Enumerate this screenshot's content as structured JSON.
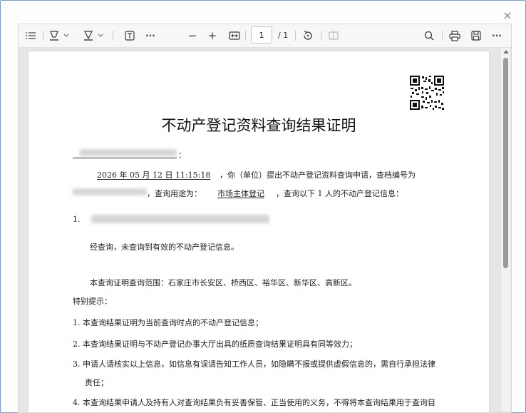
{
  "window": {
    "close_glyph": "×"
  },
  "toolbar": {
    "icons": [
      "list-icon",
      "highlight-icon",
      "draw-icon",
      "text-box-icon",
      "more-icon",
      "zoom-out-icon",
      "zoom-in-icon",
      "fit-width-icon",
      "rotate-icon",
      "page-view-icon",
      "search-icon",
      "print-icon",
      "save-icon",
      "more-icon"
    ],
    "zoom_out": "−",
    "zoom_in": "+",
    "more": "···",
    "page_current": "1",
    "page_total": "/ 1"
  },
  "document": {
    "title": "不动产登记资料查询结果证明",
    "addressee_suffix": "：",
    "query_date": "2026 年 05 月 12 日  11:15:18",
    "line1_mid": "，你（单位）提出不动产登记资料查询申请，查档编号为",
    "line2_mid": "，查询用途为：",
    "purpose": "市场主体登记",
    "line2_tail": "，查询以下 1 人的不动产登记信息：",
    "item1_number": "1.",
    "result_text": "经查询，未查询到有效的不动产登记信息。",
    "scope_text": "本查询证明查询范围：石家庄市长安区、桥西区、裕华区、新华区、高新区。",
    "notice_title": "特别提示：",
    "notices": [
      "1. 本查询结果证明为当前查询时点的不动产登记信息；",
      "2. 本查询结果证明与不动产登记办事大厅出具的纸质查询结果证明具有同等效力；",
      "3. 申请人请核实以上信息，如信息有误请告知工作人员，如隐瞒不报或提供虚假信息的，需自行承担法律",
      "责任；",
      "4. 本查询结果申请人及持有人对查询结果负有妥善保管、正当使用的义务，不得将本查询结果用于查询目"
    ]
  },
  "colors": {
    "frame_border": "#7a9cc6",
    "viewer_bg": "#e6e6e6",
    "toolbar_bg": "#f7f7f7"
  }
}
